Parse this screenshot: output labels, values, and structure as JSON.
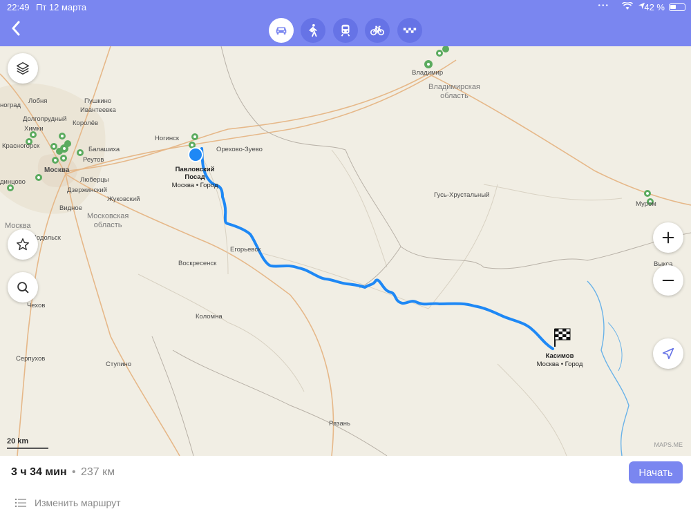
{
  "status_bar": {
    "time": "22:49",
    "date": "Пт 12 марта",
    "battery": "42 %",
    "icons": [
      "wifi-icon",
      "location-arrow-icon",
      "battery-icon"
    ]
  },
  "header": {
    "back_icon": "chevron-left-icon",
    "modes": [
      {
        "name": "car",
        "icon": "car-icon",
        "active": true
      },
      {
        "name": "walk",
        "icon": "pedestrian-icon",
        "active": false
      },
      {
        "name": "transit",
        "icon": "train-icon",
        "active": false
      },
      {
        "name": "bike",
        "icon": "bicycle-icon",
        "active": false
      },
      {
        "name": "taxi",
        "icon": "taxi-icon",
        "active": false
      }
    ]
  },
  "map": {
    "cities": {
      "vladimir": "Владимир",
      "pushkino": "Пушкино",
      "ivanteevka": "Ивантеевка",
      "korolev": "Королёв",
      "dolgoprudny": "Долгопрудный",
      "khimki": "Химки",
      "krasnogorsk": "Красногорск",
      "moscow": "Москва",
      "balashikha": "Балашиха",
      "reutov": "Реутов",
      "lyubertsy": "Люберцы",
      "odintsovo": "динцово",
      "dzerzhinsky": "Дзержинский",
      "zhukovsky": "Жуковский",
      "vidnoe": "Видное",
      "podolsk": "Подольск",
      "chekhov": "Чехов",
      "serpukhov": "Серпухов",
      "stupino": "Ступино",
      "kolomna": "Коломна",
      "voskresensk": "Воскресенск",
      "egoryevsk": "Егорьевск",
      "noginsk": "Ногинск",
      "orekhovo": "Орехово-Зуево",
      "gus": "Гусь-Хрустальный",
      "ryazan": "Рязань",
      "murom": "Муром",
      "vyksa": "Выкса",
      "lobnya": "Лобня",
      "nograd": "ноград"
    },
    "regions": {
      "vladimir_oblast": "Владимирская\nобласть",
      "moscow_oblast": "Московская\nобласть",
      "moscow_left": "Москва"
    },
    "start": {
      "name": "Павловский\nПосад",
      "sub": "Москва • Город"
    },
    "finish": {
      "name": "Касимов",
      "sub": "Москва • Город"
    },
    "scale": "20 km",
    "attribution": "MAPS.ME",
    "controls": [
      "layers-icon",
      "star-icon",
      "search-icon",
      "zoom-in-icon",
      "zoom-out-icon",
      "navigation-arrow-icon"
    ]
  },
  "route": {
    "duration": "3 ч 34 мин",
    "separator": "•",
    "distance": "237 км",
    "start_label": "Начать",
    "edit_label": "Изменить маршрут"
  },
  "colors": {
    "header": "#7a86f0",
    "route": "#1e88f5",
    "pin": "#5bab5f"
  }
}
